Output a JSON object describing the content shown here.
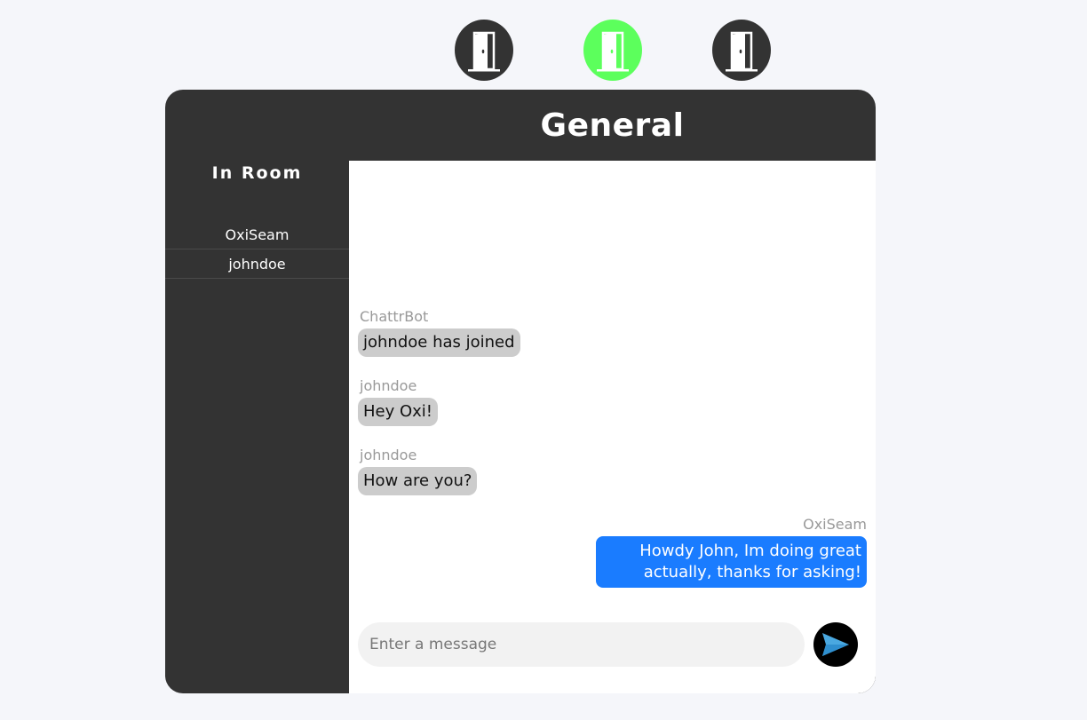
{
  "rooms": [
    {
      "name": "room-1",
      "icon": "door-icon",
      "active": false
    },
    {
      "name": "room-2",
      "icon": "door-icon",
      "active": true
    },
    {
      "name": "room-3",
      "icon": "door-icon",
      "active": false
    }
  ],
  "colors": {
    "panel": "#333333",
    "active_room": "#5cff5c",
    "own_bubble": "#1a7cff",
    "other_bubble": "#cccccc",
    "send_arrow": "#4aa8e0"
  },
  "room": {
    "title": "General"
  },
  "sidebar": {
    "heading": "In Room",
    "users": [
      "OxiSeam",
      "johndoe"
    ]
  },
  "messages": [
    {
      "sender": "ChattrBot",
      "text": "johndoe has joined",
      "mine": false
    },
    {
      "sender": "johndoe",
      "text": "Hey Oxi!",
      "mine": false
    },
    {
      "sender": "johndoe",
      "text": "How are you?",
      "mine": false
    },
    {
      "sender": "OxiSeam",
      "text": "Howdy John, Im doing great actually, thanks for asking!",
      "mine": true
    }
  ],
  "composer": {
    "placeholder": "Enter a message",
    "value": "",
    "send_icon": "send-icon"
  }
}
